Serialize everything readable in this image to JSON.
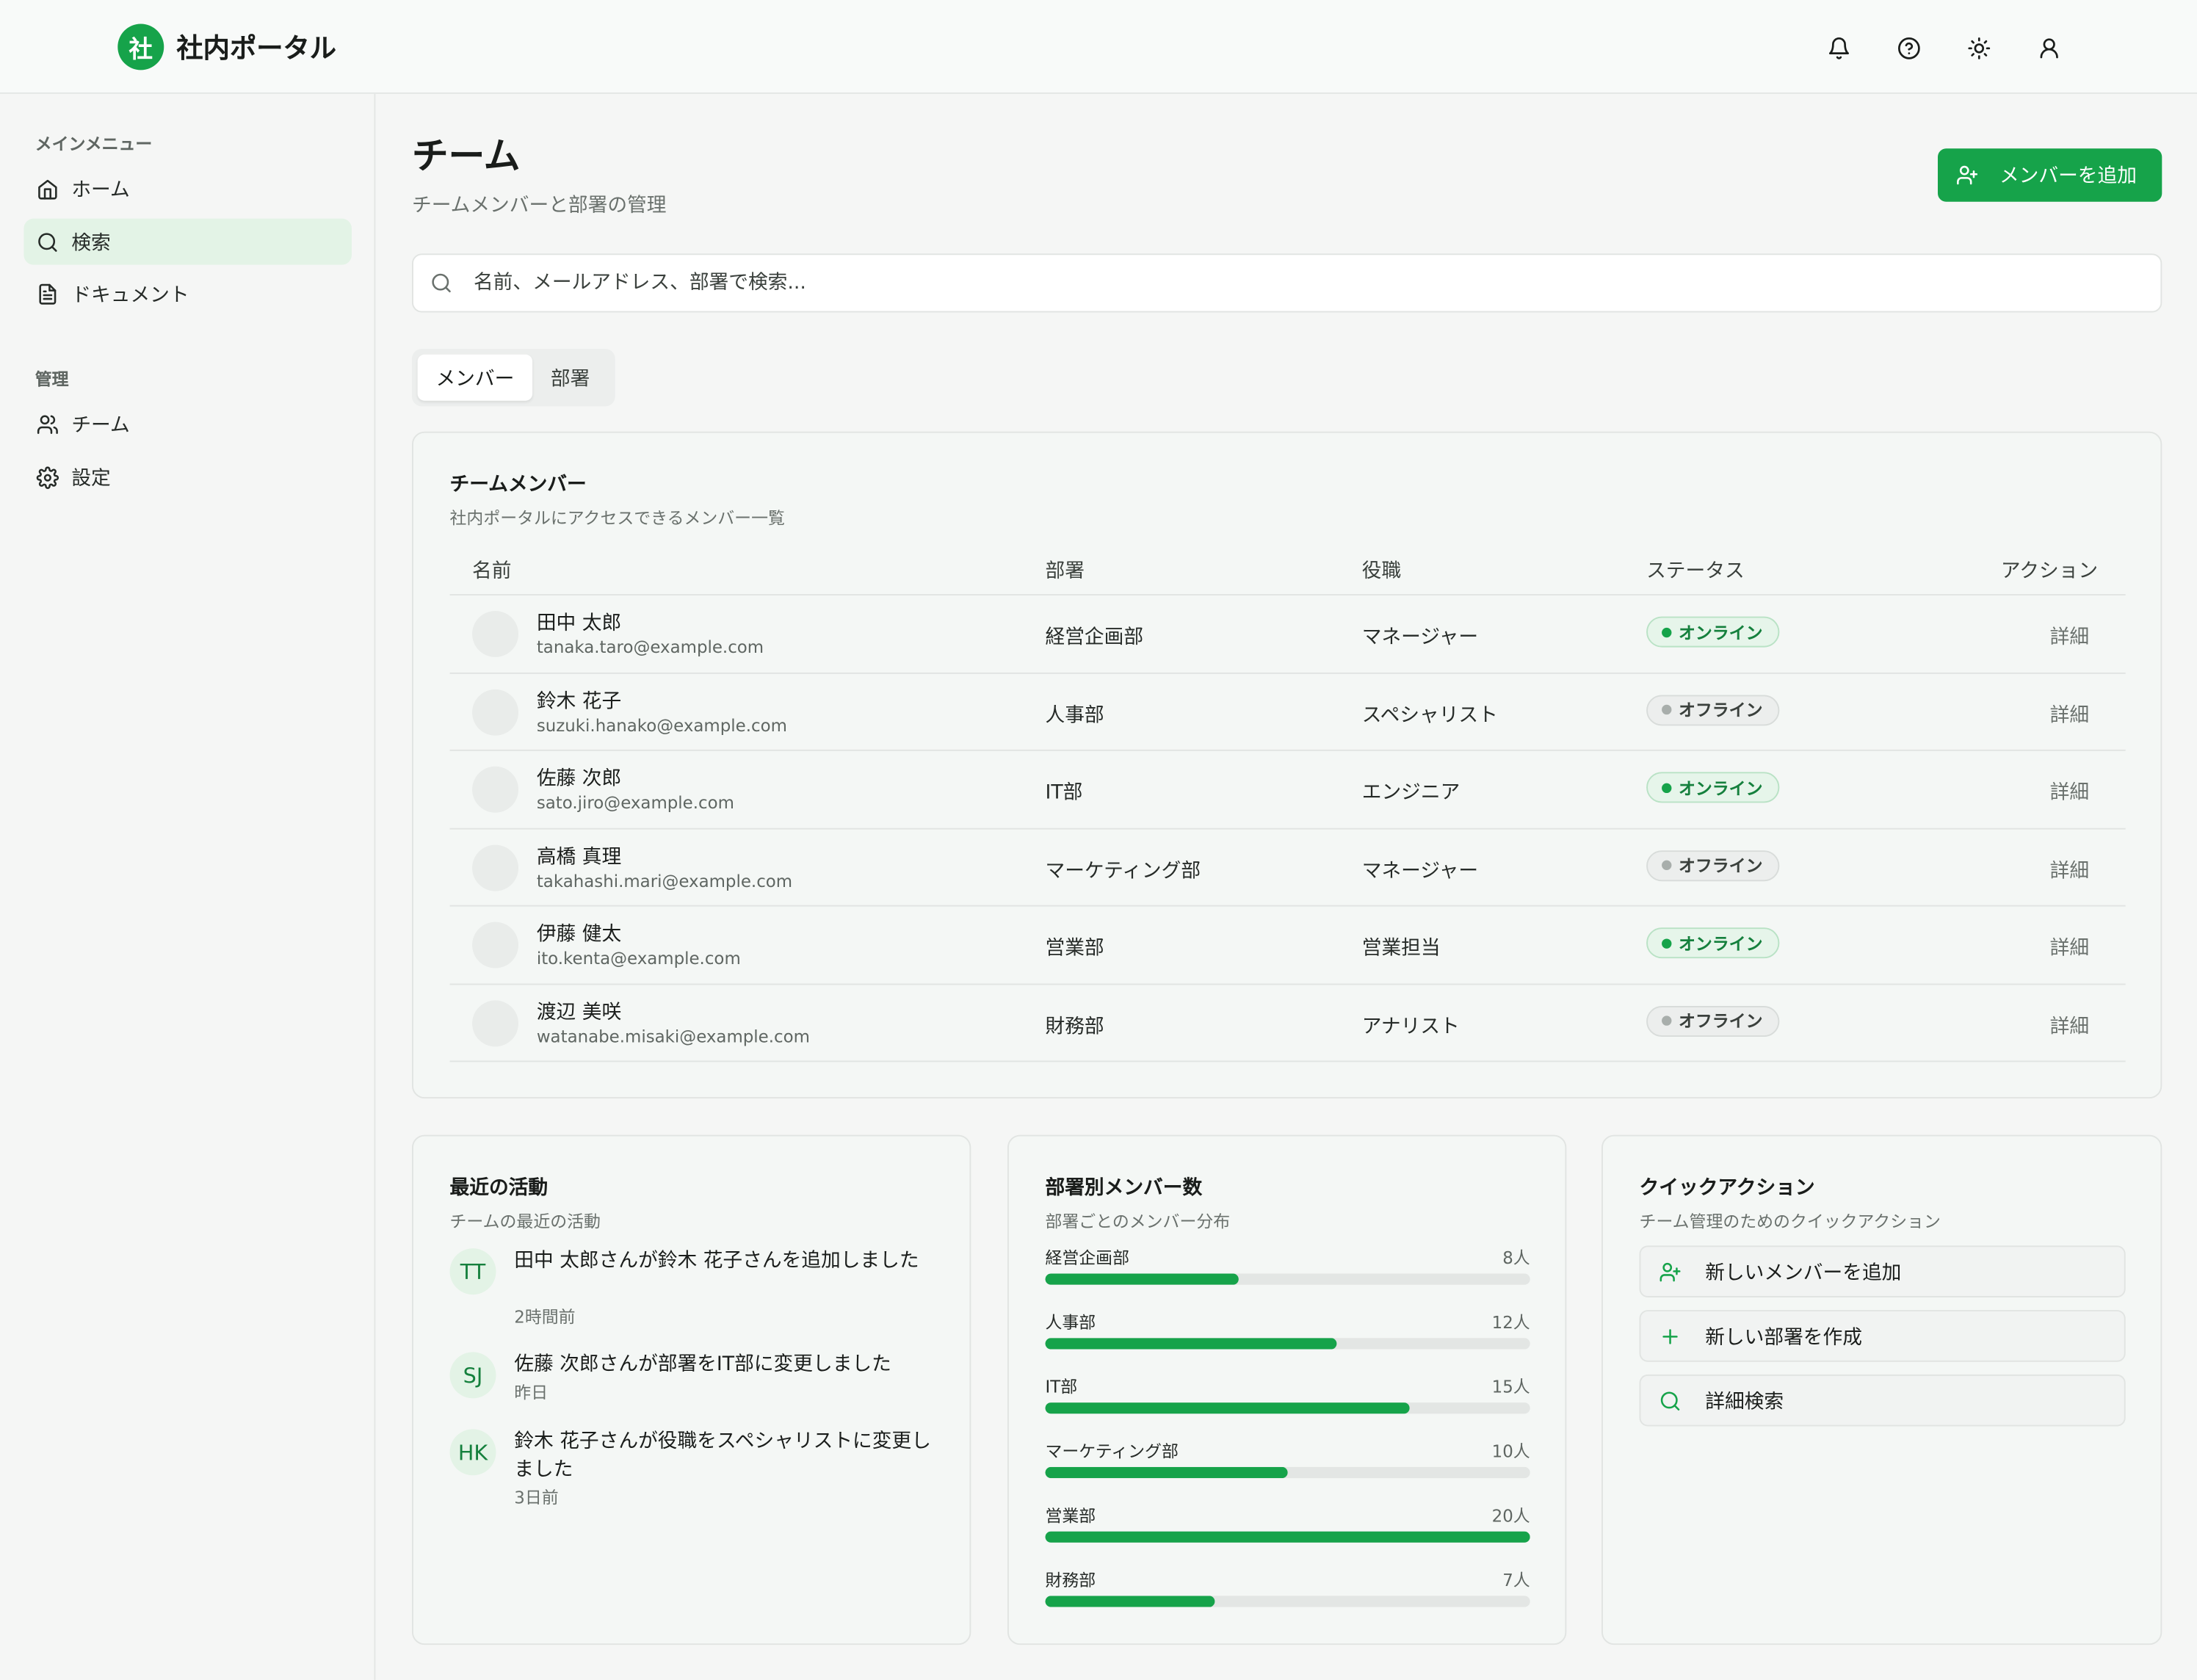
{
  "header": {
    "logo_char": "社",
    "app_title": "社内ポータル",
    "icons": [
      "bell-icon",
      "help-circle-icon",
      "sun-icon",
      "user-icon"
    ]
  },
  "sidebar": {
    "main_label": "メインメニュー",
    "main_items": [
      {
        "label": "ホーム",
        "icon": "home-icon"
      },
      {
        "label": "検索",
        "icon": "search-icon",
        "active": true
      },
      {
        "label": "ドキュメント",
        "icon": "document-icon"
      }
    ],
    "admin_label": "管理",
    "admin_items": [
      {
        "label": "チーム",
        "icon": "users-icon"
      },
      {
        "label": "設定",
        "icon": "gear-icon"
      }
    ]
  },
  "page": {
    "title": "チーム",
    "subtitle": "チームメンバーと部署の管理",
    "add_button": "メンバーを追加"
  },
  "search": {
    "placeholder": "名前、メールアドレス、部署で検索...",
    "value": ""
  },
  "tabs": [
    {
      "label": "メンバー",
      "active": true
    },
    {
      "label": "部署",
      "active": false
    }
  ],
  "members_card": {
    "title": "チームメンバー",
    "subtitle": "社内ポータルにアクセスできるメンバー一覧",
    "columns": [
      "名前",
      "部署",
      "役職",
      "ステータス",
      "アクション"
    ],
    "rows": [
      {
        "name": "田中 太郎",
        "email": "tanaka.taro@example.com",
        "dept": "経営企画部",
        "role": "マネージャー",
        "status": "オンライン",
        "online": true,
        "action": "詳細"
      },
      {
        "name": "鈴木 花子",
        "email": "suzuki.hanako@example.com",
        "dept": "人事部",
        "role": "スペシャリスト",
        "status": "オフライン",
        "online": false,
        "action": "詳細"
      },
      {
        "name": "佐藤 次郎",
        "email": "sato.jiro@example.com",
        "dept": "IT部",
        "role": "エンジニア",
        "status": "オンライン",
        "online": true,
        "action": "詳細"
      },
      {
        "name": "高橋 真理",
        "email": "takahashi.mari@example.com",
        "dept": "マーケティング部",
        "role": "マネージャー",
        "status": "オフライン",
        "online": false,
        "action": "詳細"
      },
      {
        "name": "伊藤 健太",
        "email": "ito.kenta@example.com",
        "dept": "営業部",
        "role": "営業担当",
        "status": "オンライン",
        "online": true,
        "action": "詳細"
      },
      {
        "name": "渡辺 美咲",
        "email": "watanabe.misaki@example.com",
        "dept": "財務部",
        "role": "アナリスト",
        "status": "オフライン",
        "online": false,
        "action": "詳細"
      }
    ]
  },
  "activity_card": {
    "title": "最近の活動",
    "subtitle": "チームの最近の活動",
    "items": [
      {
        "initials": "TT",
        "text": "田中 太郎さんが鈴木 花子さんを追加しました",
        "time": "2時間前"
      },
      {
        "initials": "SJ",
        "text": "佐藤 次郎さんが部署をIT部に変更しました",
        "time": "昨日"
      },
      {
        "initials": "HK",
        "text": "鈴木 花子さんが役職をスペシャリストに変更しました",
        "time": "3日前"
      }
    ]
  },
  "dept_card": {
    "title": "部署別メンバー数",
    "subtitle": "部署ごとのメンバー分布",
    "max": 20,
    "items": [
      {
        "name": "経営企画部",
        "count": 8,
        "label": "8人"
      },
      {
        "name": "人事部",
        "count": 12,
        "label": "12人"
      },
      {
        "name": "IT部",
        "count": 15,
        "label": "15人"
      },
      {
        "name": "マーケティング部",
        "count": 10,
        "label": "10人"
      },
      {
        "name": "営業部",
        "count": 20,
        "label": "20人"
      },
      {
        "name": "財務部",
        "count": 7,
        "label": "7人"
      }
    ]
  },
  "quick_card": {
    "title": "クイックアクション",
    "subtitle": "チーム管理のためのクイックアクション",
    "items": [
      {
        "label": "新しいメンバーを追加",
        "icon": "user-plus-icon"
      },
      {
        "label": "新しい部署を作成",
        "icon": "plus-icon"
      },
      {
        "label": "詳細検索",
        "icon": "search-icon"
      }
    ]
  },
  "colors": {
    "accent": "#16a34a",
    "accent_light": "#e3f3e6"
  }
}
